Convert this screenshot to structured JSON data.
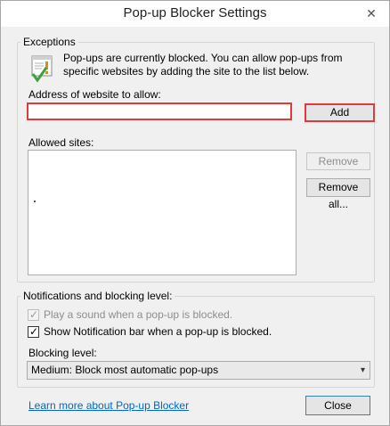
{
  "window": {
    "title": "Pop-up Blocker Settings",
    "close_glyph": "✕"
  },
  "exceptions": {
    "group_label": "Exceptions",
    "info_text": "Pop-ups are currently blocked.  You can allow pop-ups from specific websites by adding the site to the list below.",
    "address_label": "Address of website to allow:",
    "address_value": "",
    "add_label": "Add",
    "allowed_sites_label": "Allowed sites:",
    "allowed_sites": [],
    "remove_label": "Remove",
    "remove_all_label": "Remove all..."
  },
  "notifications": {
    "group_label": "Notifications and blocking level:",
    "play_sound_label": "Play a sound when a pop-up is blocked.",
    "play_sound_checked": true,
    "play_sound_enabled": false,
    "show_bar_label": "Show Notification bar when a pop-up is blocked.",
    "show_bar_checked": true,
    "blocking_level_label": "Blocking level:",
    "blocking_level_value": "Medium: Block most automatic pop-ups"
  },
  "footer": {
    "learn_more_label": "Learn more about Pop-up Blocker",
    "close_label": "Close"
  },
  "icons": {
    "info_icon": "popup-blocked-icon",
    "checkmark": "✓",
    "dropdown": "▾"
  },
  "colors": {
    "highlight": "#e0393e",
    "link": "#0066cc"
  }
}
